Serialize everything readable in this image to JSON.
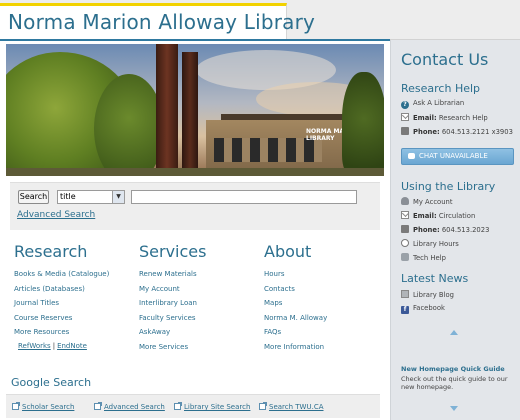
{
  "header": {
    "title": "Norma Marion Alloway Library",
    "accent_color": "#f2d200",
    "brand_color": "#2c6f8e"
  },
  "hero": {
    "building_sign": "NORMA MARION\nLIBRARY"
  },
  "search": {
    "button_label": "Search",
    "field_selected": "title",
    "query_value": "",
    "advanced_label": "Advanced Search"
  },
  "columns": [
    {
      "heading": "Research",
      "links": [
        "Books & Media (Catalogue)",
        "Articles (Databases)",
        "Journal Titles",
        "Course Reserves",
        "More Resources"
      ]
    },
    {
      "heading": "Services",
      "links": [
        "Renew Materials",
        "My Account",
        "Interlibrary Loan",
        "Faculty Services",
        "AskAway",
        "More Services"
      ]
    },
    {
      "heading": "About",
      "links": [
        "Hours",
        "Contacts",
        "Maps",
        "Norma M. Alloway",
        "FAQs",
        "More Information"
      ]
    }
  ],
  "research_extras": {
    "refworks": "RefWorks",
    "separator": "|",
    "endnote": "EndNote"
  },
  "google_search": {
    "title": "Google Search",
    "links": [
      "Scholar Search",
      "Advanced Search",
      "Library Site Search",
      "Search TWU.CA"
    ]
  },
  "sidebar": {
    "title": "Contact Us",
    "research_help": {
      "heading": "Research Help",
      "ask": "Ask A Librarian",
      "email_label": "Email:",
      "email_value": "Research Help",
      "phone_label": "Phone:",
      "phone_value": "604.513.2121 x3903",
      "chat_label": "CHAT UNAVAILABLE"
    },
    "using_library": {
      "heading": "Using the Library",
      "account": "My Account",
      "email_label": "Email:",
      "email_value": "Circulation",
      "phone_label": "Phone:",
      "phone_value": "604.513.2023",
      "hours": "Library Hours",
      "tech": "Tech Help"
    },
    "latest_news": {
      "heading": "Latest News",
      "blog": "Library Blog",
      "facebook": "Facebook"
    },
    "quick_guide": {
      "title": "New Homepage Quick Guide",
      "text": "Check out the quick guide to our new homepage."
    }
  }
}
